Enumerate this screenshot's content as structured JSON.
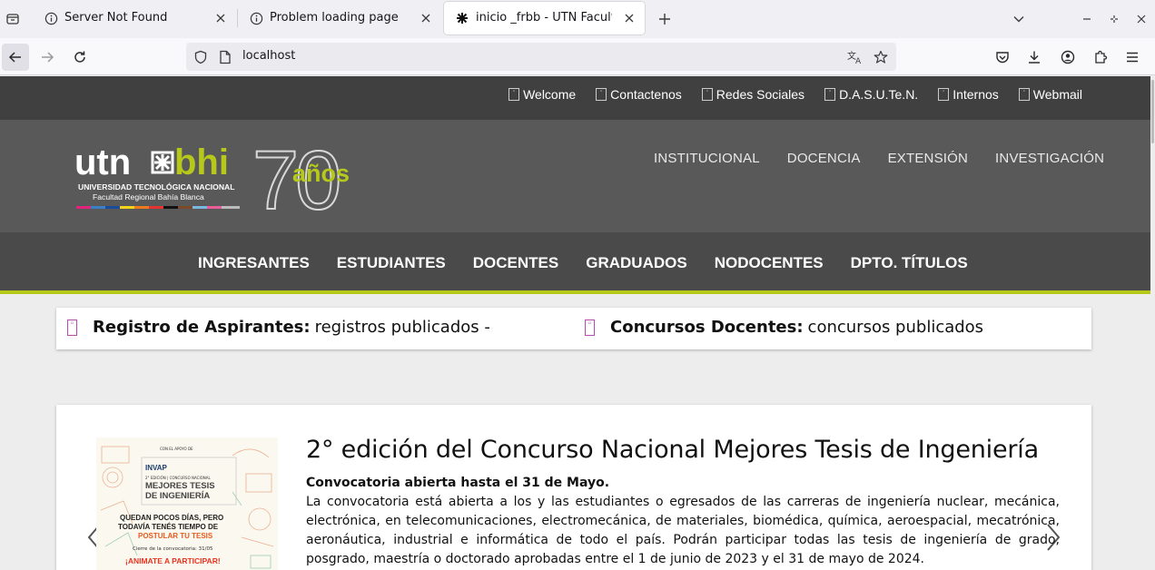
{
  "tabs": [
    {
      "title": "Server Not Found"
    },
    {
      "title": "Problem loading page"
    },
    {
      "title": "inicio _frbb - UTN Facultad Regional Bahía Blanca"
    }
  ],
  "urlbar": {
    "url": "localhost"
  },
  "site": {
    "toplinks": [
      "Welcome",
      "Contactenos",
      "Redes Sociales",
      "D.A.S.U.Te.N.",
      "Internos",
      "Webmail"
    ],
    "logo": {
      "utn": "utn",
      "bhi": "bhi",
      "line1": "UNIVERSIDAD TECNOLÓGICA NACIONAL",
      "line2": "Facultad Regional Bahía Blanca",
      "years": "70",
      "anos": "años"
    },
    "mainnav": [
      "INSTITUCIONAL",
      "DOCENCIA",
      "EXTENSIÓN",
      "INVESTIGACIÓN"
    ],
    "categories": [
      "INGRESANTES",
      "ESTUDIANTES",
      "DOCENTES",
      "GRADUADOS",
      "NODOCENTES",
      "DPTO. TÍTULOS"
    ],
    "notices": [
      {
        "label": "Registro de Aspirantes:",
        "text": "registros publicados -"
      },
      {
        "label": "Concursos Docentes:",
        "text": "concursos publicados"
      }
    ],
    "featured": {
      "title": "2° edición del Concurso Nacional Mejores Tesis de Ingeniería",
      "lead": "Convocatoria abierta hasta el 31 de Mayo.",
      "body": "La convocatoria está abierta a los y las estudiantes o egresados de las carreras de ingeniería nuclear, mecánica, electrónica, en telecomunicaciones, electromecánica, de materiales, biomédica, química, aeroespacial, mecatrónica, aeronáutica, industrial e informática de todo el país. Podrán participar todas las tesis de ingeniería de grado, posgrado, maestría o doctorado aprobadas entre el 1 de junio de 2023 y el 31 de mayo de 2024.",
      "poster": {
        "support": "CON EL APOYO DE",
        "brand": "INVAP",
        "edition": "2° EDICIÓN | CONCURSO NACIONAL",
        "title": "MEJORES TESIS DE INGENIERÍA",
        "line1": "QUEDAN POCOS DÍAS, PERO",
        "line2": "TODAVÍA TENÉS TIEMPO DE",
        "cta": "POSTULAR TU TESIS",
        "deadline": "Cierre de la convocatoria: 31/05",
        "animate": "¡ANIMATE A PARTICIPAR!"
      }
    }
  },
  "colors": {
    "accent": "#b6c91a",
    "topbar": "#404040",
    "header": "#595959",
    "catbar": "#4a4a4a"
  }
}
